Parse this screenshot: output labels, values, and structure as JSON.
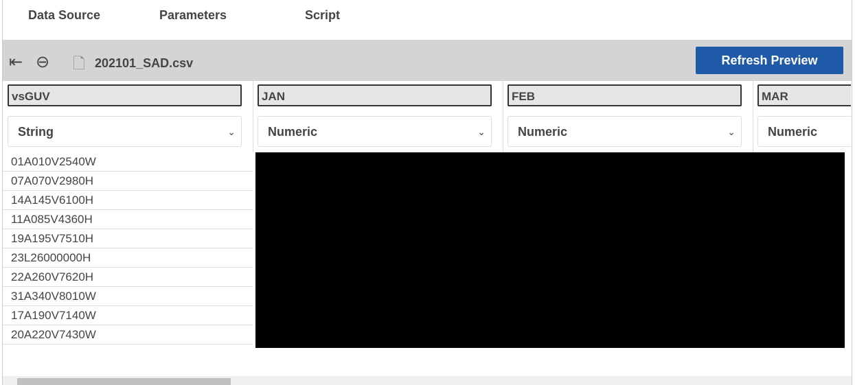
{
  "tabs": [
    "Data Source",
    "Parameters",
    "Script"
  ],
  "toolbar": {
    "file_name": "202101_SAD.csv",
    "refresh_label": "Refresh Preview",
    "accent": "#1f5aa8"
  },
  "columns": [
    {
      "name": "vsGUV",
      "type": "String"
    },
    {
      "name": "JAN",
      "type": "Numeric"
    },
    {
      "name": "FEB",
      "type": "Numeric"
    },
    {
      "name": "MAR",
      "type": "Numeric"
    }
  ],
  "rows": [
    "01A010V2540W",
    "07A070V2980H",
    "14A145V6100H",
    "11A085V4360H",
    "19A195V7510H",
    "23L26000000H",
    "22A260V7620H",
    "31A340V8010W",
    "17A190V7140W",
    "20A220V7430W"
  ]
}
